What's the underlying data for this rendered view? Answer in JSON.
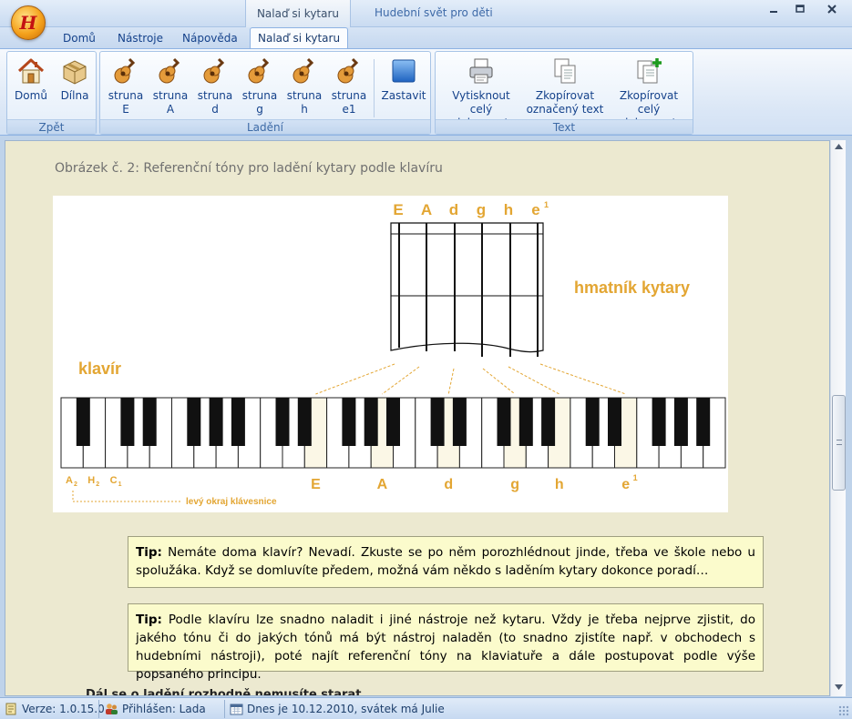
{
  "window": {
    "title": "Hudební svět pro děti",
    "context_tab_title": "Nalaď si kytaru",
    "controls": {
      "minimize": "▭",
      "maximize": "▢",
      "close": "✕"
    }
  },
  "tabs": [
    {
      "label": "Domů"
    },
    {
      "label": "Nástroje"
    },
    {
      "label": "Nápověda"
    },
    {
      "label": "Nalaď si kytaru",
      "active": true
    }
  ],
  "ribbon": {
    "groups": [
      {
        "label": "Zpět",
        "buttons": [
          {
            "label": "Domů",
            "icon": "home-icon"
          },
          {
            "label": "Dílna",
            "icon": "workshop-box-icon"
          }
        ]
      },
      {
        "label": "Ladění",
        "buttons": [
          {
            "label": "struna E",
            "line1": "struna",
            "line2": "E",
            "icon": "guitar-icon"
          },
          {
            "label": "struna A",
            "line1": "struna",
            "line2": "A",
            "icon": "guitar-icon"
          },
          {
            "label": "struna d",
            "line1": "struna",
            "line2": "d",
            "icon": "guitar-icon"
          },
          {
            "label": "struna g",
            "line1": "struna",
            "line2": "g",
            "icon": "guitar-icon"
          },
          {
            "label": "struna h",
            "line1": "struna",
            "line2": "h",
            "icon": "guitar-icon"
          },
          {
            "label": "struna e1",
            "line1": "struna",
            "line2": "e1",
            "icon": "guitar-icon"
          },
          {
            "label": "Zastavit",
            "icon": "stop-icon"
          }
        ]
      },
      {
        "label": "Text",
        "buttons": [
          {
            "line1": "Vytisknout",
            "line2": "celý dokument",
            "icon": "printer-icon"
          },
          {
            "line1": "Zkopírovat",
            "line2": "označený text",
            "icon": "copy-icon"
          },
          {
            "line1": "Zkopírovat",
            "line2": "celý dokument",
            "icon": "copy-add-icon"
          }
        ]
      }
    ]
  },
  "content": {
    "figure_caption": "Obrázek č. 2: Referenční tóny pro ladění kytary podle klavíru",
    "figure": {
      "string_labels": [
        "E",
        "A",
        "d",
        "g",
        "h",
        "e"
      ],
      "string_label_sup": "1",
      "fretboard_label": "hmatník kytary",
      "piano_label": "klavír",
      "low_keys": [
        {
          "letter": "A",
          "sub": "2"
        },
        {
          "letter": "H",
          "sub": "2"
        },
        {
          "letter": "C",
          "sub": "1"
        }
      ],
      "left_edge_label": "levý okraj klávesnice",
      "highlight_colors": {
        "accent": "#e3a633",
        "key_highlight": "#fbf7e6"
      }
    },
    "tip1": {
      "prefix": "Tip:",
      "text": " Nemáte doma klavír? Nevadí. Zkuste se po něm porozhlédnout jinde, třeba ve škole nebo u spolužáka. Když se domluvíte předem, možná vám někdo s laděním kytary dokonce poradí…"
    },
    "tip2": {
      "prefix": "Tip:",
      "text": " Podle klavíru lze snadno naladit i jiné nástroje než kytaru. Vždy je třeba  nejprve zjistit, do jakého tónu či do jakých tónů má být nástroj naladěn (to snadno zjistíte např. v obchodech s hudebními nástroji), poté najít referenční tóny na klaviatuře a dále postupovat podle výše popsaného principu."
    },
    "cut_text": "Dál se o ladění rozhodně nemusíte starat, ... "
  },
  "statusbar": {
    "version": "Verze: 1.0.15.0",
    "user": "Přihlášen: Lada",
    "date": "Dnes je 10.12.2010, svátek má Julie"
  }
}
